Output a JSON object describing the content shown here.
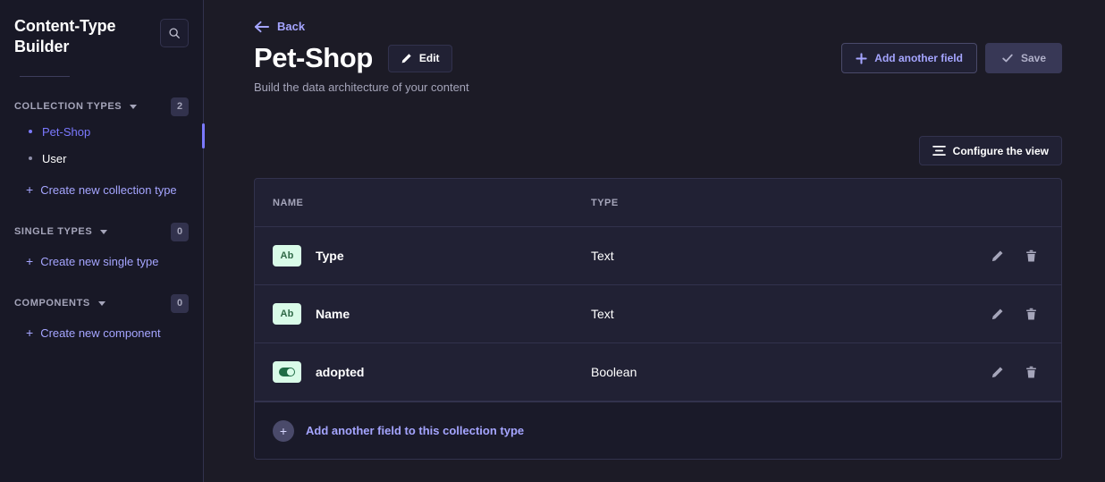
{
  "sidebar": {
    "title": "Content-Type Builder",
    "search_icon": "search-icon",
    "groups": [
      {
        "label": "COLLECTION TYPES",
        "count": "2",
        "items": [
          {
            "label": "Pet-Shop",
            "active": true
          },
          {
            "label": "User",
            "active": false
          }
        ],
        "create_label": "Create new collection type"
      },
      {
        "label": "SINGLE TYPES",
        "count": "0",
        "items": [],
        "create_label": "Create new single type"
      },
      {
        "label": "COMPONENTS",
        "count": "0",
        "items": [],
        "create_label": "Create new component"
      }
    ]
  },
  "header": {
    "back_label": "Back",
    "title": "Pet-Shop",
    "edit_label": "Edit",
    "subtitle": "Build the data architecture of your content",
    "add_field_label": "Add another field",
    "save_label": "Save"
  },
  "toolbar": {
    "configure_label": "Configure the view"
  },
  "table": {
    "columns": {
      "name": "NAME",
      "type": "TYPE"
    },
    "rows": [
      {
        "name": "Type",
        "type": "Text",
        "icon": "text-field-icon",
        "icon_text": "Ab"
      },
      {
        "name": "Name",
        "type": "Text",
        "icon": "text-field-icon",
        "icon_text": "Ab"
      },
      {
        "name": "adopted",
        "type": "Boolean",
        "icon": "boolean-toggle-icon",
        "icon_text": ""
      }
    ],
    "footer_label": "Add another field to this collection type"
  },
  "colors": {
    "accent": "#7b79ff",
    "link": "#a5a5ff",
    "app_background": "#1c1b26",
    "sidebar_background": "#181826",
    "card_background": "#212134",
    "border": "#32324d",
    "muted_text": "#a5a5ba",
    "icon_green_bg": "#d9fbe8",
    "icon_green_fg": "#2f6846"
  }
}
